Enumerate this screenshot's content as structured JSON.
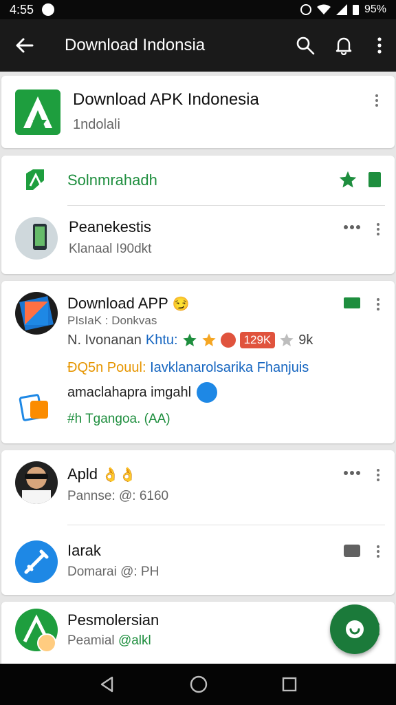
{
  "status": {
    "time": "4:55",
    "battery": "95",
    "battery_symbol": "%"
  },
  "appbar": {
    "title": "Download Indonsia"
  },
  "card1": {
    "title": "Download APK Indonesia",
    "subtitle": "1ndolali"
  },
  "card2": {
    "header_label": "Solnmrahadh",
    "item_title": "Peanekestis",
    "item_subtitle": "Klanaal I90dkt"
  },
  "card3": {
    "title": "Download APP",
    "title_emoji": "😏",
    "meta": "PIsIaK : Donkvas",
    "stats_prefix": "N. Ivonanan",
    "stats_label": "Khtu:",
    "badge_value": "129K",
    "stat_count": "9k",
    "desc_prefix": "ĐQ5n Pouul:",
    "desc_link": "Iavklanarolsarika Fhanjuis",
    "desc_line2": "amaclahapra imgahl",
    "hashtag": "#h Tgangoa. (AA)"
  },
  "card4": {
    "item1_title": "Apld",
    "item1_emoji": "👌👌",
    "item1_subtitle": "Pannse: @: 6160",
    "item2_title": "Iarak",
    "item2_subtitle": "Domarai @: PH"
  },
  "card5": {
    "title": "Pesmolersian",
    "subtitle_prefix": "Peamial",
    "subtitle_link": "@alkl"
  },
  "colors": {
    "accent": "#1e8e3e",
    "link": "#1565c0",
    "badge": "#e0533d",
    "star": "#f5a623",
    "orange_text": "#e69500"
  }
}
